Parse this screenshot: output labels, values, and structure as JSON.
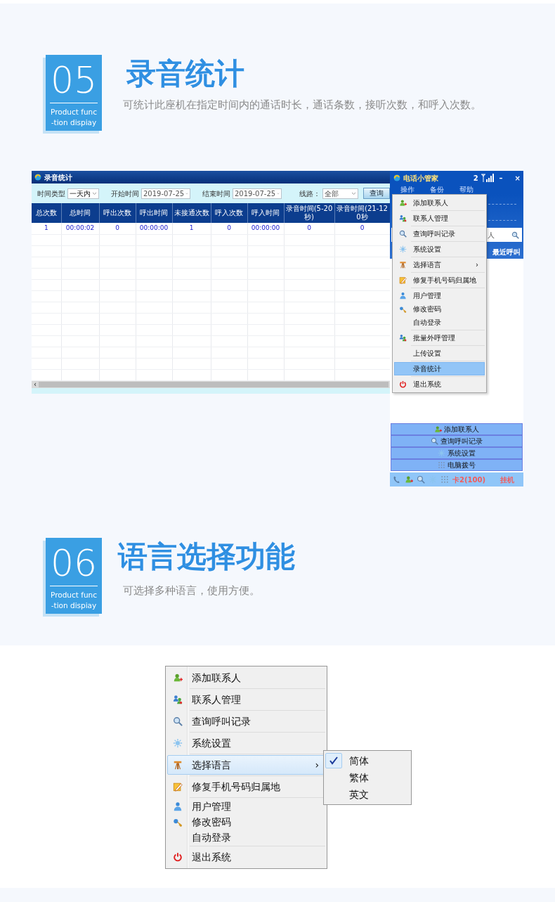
{
  "section_1": {
    "number": "05",
    "badge_lines": [
      "Product func",
      "-tion dispiay"
    ],
    "title": "录音统计",
    "subtitle": "可统计此座机在指定时间内的通话时长，通话条数，接听次数，和呼入次数。"
  },
  "stats_window": {
    "title": "录音统计",
    "filters": [
      {
        "label": "时间类型",
        "value": "一天内"
      },
      {
        "label": "开始时间",
        "value": "2019-07-25"
      },
      {
        "label": "结束时间",
        "value": "2019-07-25"
      },
      {
        "label": "线路：",
        "value": "全部"
      }
    ],
    "query_button": "查询",
    "columns": [
      "总次数",
      "总时间",
      "呼出次数",
      "呼出时间",
      "未接通次数",
      "呼入次数",
      "呼入时间",
      "录音时间(5-20秒)",
      "录音时间(21-120秒"
    ],
    "rows": [
      [
        "1",
        "00:00:02",
        "0",
        "00:00:00",
        "1",
        "0",
        "00:00:00",
        "0",
        "0"
      ]
    ],
    "scroll_left": "‹"
  },
  "phone_app": {
    "title": "电话小管家",
    "signal_number": "2",
    "minimize": "–",
    "close": "×",
    "menu_bar": [
      "操作",
      "备份",
      "帮助"
    ],
    "search_text": "人",
    "tab": "最近呼叫",
    "menu": {
      "groups": [
        [
          {
            "label": "添加联系人",
            "kind": "add",
            "selected": false
          }
        ],
        [
          {
            "label": "联系人管理",
            "kind": "contacts",
            "selected": false
          }
        ],
        [
          {
            "label": "查询呼叫记录",
            "kind": "search",
            "selected": false
          }
        ],
        [
          {
            "label": "系统设置",
            "kind": "settings",
            "selected": false
          }
        ],
        [
          {
            "label": "选择语言",
            "kind": "language",
            "selected": false,
            "arrow": "›"
          }
        ],
        [
          {
            "label": "修复手机号码归属地",
            "kind": "edit",
            "selected": false
          }
        ],
        [
          {
            "label": "用户管理",
            "kind": "user",
            "selected": false
          },
          {
            "label": "修改密码",
            "kind": "key",
            "selected": false
          },
          {
            "label": "自动登录",
            "kind": "plain",
            "selected": false
          }
        ],
        [
          {
            "label": "批量外呼管理",
            "kind": "contacts",
            "selected": false
          }
        ],
        [
          {
            "label": "上传设置",
            "kind": "plain",
            "selected": false
          }
        ],
        [
          {
            "label": "录音统计",
            "kind": "plain",
            "selected": true
          }
        ],
        [
          {
            "label": "退出系统",
            "kind": "exit",
            "selected": false
          }
        ]
      ]
    },
    "buttons": [
      {
        "label": "添加联系人",
        "kind": "add"
      },
      {
        "label": "查询呼叫记录",
        "kind": "search"
      },
      {
        "label": "系统设置",
        "kind": "settings"
      },
      {
        "label": "电脑拨号",
        "kind": "keypad"
      }
    ],
    "status_bar": {
      "card": "卡2(100)",
      "hangup": "挂机"
    }
  },
  "section_2": {
    "number": "06",
    "badge_lines": [
      "Product func",
      "-tion dispiay"
    ],
    "title": "语言选择功能",
    "subtitle": "可选择多种语言，使用方便。"
  },
  "language_menu": {
    "groups": [
      [
        {
          "label": "添加联系人",
          "kind": "add",
          "selected": false
        }
      ],
      [
        {
          "label": "联系人管理",
          "kind": "contacts",
          "selected": false
        }
      ],
      [
        {
          "label": "查询呼叫记录",
          "kind": "search",
          "selected": false
        }
      ],
      [
        {
          "label": "系统设置",
          "kind": "settings",
          "selected": false
        }
      ],
      [
        {
          "label": "选择语言",
          "kind": "language",
          "selected": true,
          "arrow": "›"
        }
      ],
      [
        {
          "label": "修复手机号码归属地",
          "kind": "edit",
          "selected": false
        }
      ],
      [
        {
          "label": "用户管理",
          "kind": "user",
          "selected": false
        },
        {
          "label": "修改密码",
          "kind": "key",
          "selected": false
        },
        {
          "label": "自动登录",
          "kind": "plain",
          "selected": false
        }
      ],
      [
        {
          "label": "退出系统",
          "kind": "exit",
          "selected": false
        }
      ]
    ],
    "submenu": [
      {
        "label": "简体",
        "checked": true
      },
      {
        "label": "繁体",
        "checked": false
      },
      {
        "label": "英文",
        "checked": false
      }
    ]
  }
}
